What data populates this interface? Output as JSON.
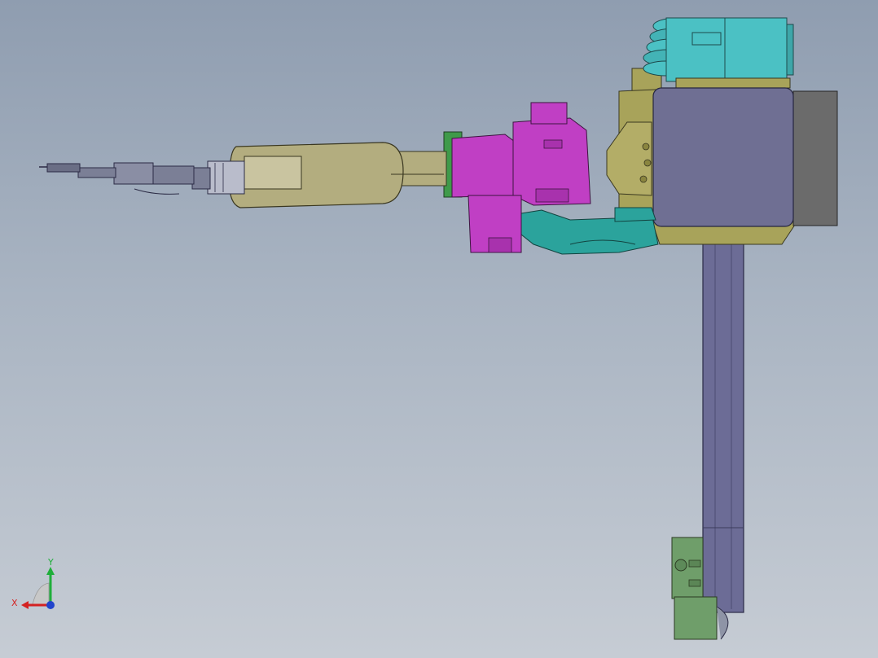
{
  "viewport": {
    "background_top": "#8f9db0",
    "background_bottom": "#c6ccd4"
  },
  "model": {
    "colors": {
      "arm_tan": "#b3ad7f",
      "base_olive": "#a8a35a",
      "joint_magenta": "#c03fc4",
      "cable_teal": "#2ba39c",
      "motor_cyan": "#4bc1c4",
      "plate_slate": "#6f6f93",
      "rail_purple": "#6c6c96",
      "bracket_gray": "#6b6b6b",
      "sensor_green": "#6f9e6a",
      "tool_steel": "#7b7f96"
    }
  },
  "triad": {
    "y_label": "Y",
    "x_label": "X",
    "y_color": "#1fae3a",
    "x_color": "#d42222",
    "z_color": "#2244cc"
  }
}
